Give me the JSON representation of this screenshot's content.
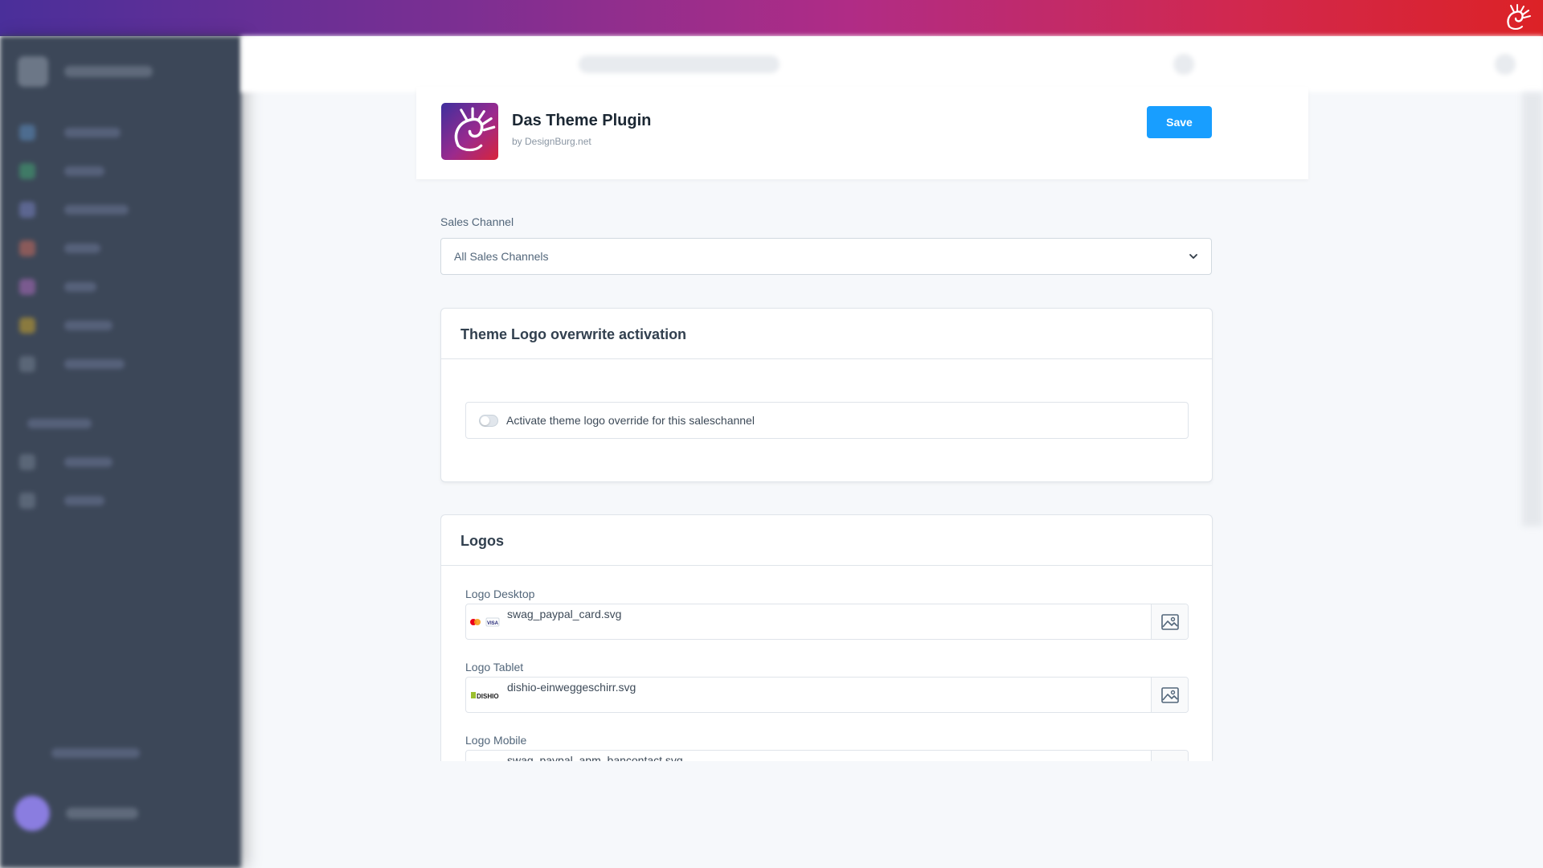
{
  "header": {
    "plugin_title": "Das Theme Plugin",
    "plugin_vendor": "by DesignBurg.net",
    "save_label": "Save"
  },
  "sales_channel": {
    "label": "Sales Channel",
    "value": "All Sales Channels"
  },
  "theme_logo_card": {
    "title": "Theme Logo overwrite activation",
    "toggle_label": "Activate theme logo override for this saleschannel",
    "toggle_on": false
  },
  "logos_card": {
    "title": "Logos",
    "fields": [
      {
        "label": "Logo Desktop",
        "filename": "swag_paypal_card.svg",
        "thumb": "card-brands-icon"
      },
      {
        "label": "Logo Tablet",
        "filename": "dishio-einweggeschirr.svg",
        "thumb": "dishio-logo-icon"
      },
      {
        "label": "Logo Mobile",
        "filename": "swag_paypal_apm_bancontact.svg",
        "thumb": "bancontact-icon"
      }
    ]
  },
  "colors": {
    "primary_button": "#189eff",
    "gradient_start": "#4a2f9a",
    "gradient_end": "#dc2226"
  }
}
